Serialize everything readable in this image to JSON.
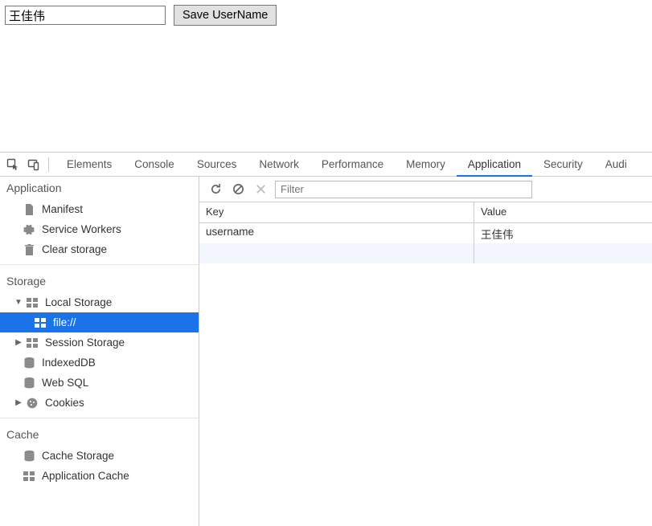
{
  "page": {
    "username_input_value": "王佳伟",
    "save_button_label": "Save UserName"
  },
  "devtools": {
    "tabs": [
      "Elements",
      "Console",
      "Sources",
      "Network",
      "Performance",
      "Memory",
      "Application",
      "Security",
      "Audi"
    ],
    "active_tab": "Application",
    "sidebar": {
      "application_heading": "Application",
      "application_items": {
        "manifest": "Manifest",
        "service_workers": "Service Workers",
        "clear_storage": "Clear storage"
      },
      "storage_heading": "Storage",
      "storage_items": {
        "local_storage": "Local Storage",
        "local_storage_child": "file://",
        "session_storage": "Session Storage",
        "indexeddb": "IndexedDB",
        "websql": "Web SQL",
        "cookies": "Cookies"
      },
      "cache_heading": "Cache",
      "cache_items": {
        "cache_storage": "Cache Storage",
        "app_cache": "Application Cache"
      }
    },
    "main": {
      "filter_placeholder": "Filter",
      "columns": {
        "key": "Key",
        "value": "Value"
      },
      "rows": [
        {
          "key": "username",
          "value": "王佳伟"
        }
      ]
    }
  }
}
